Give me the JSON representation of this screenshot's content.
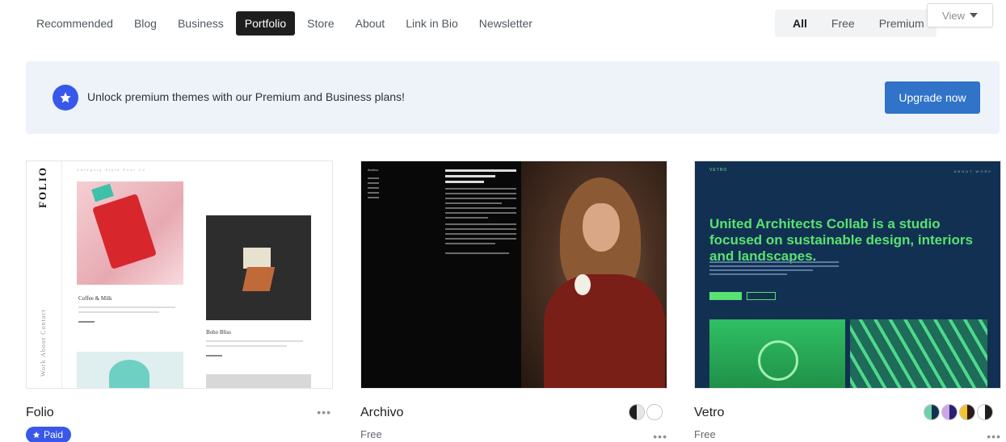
{
  "nav": {
    "items": [
      {
        "label": "Recommended",
        "active": false
      },
      {
        "label": "Blog",
        "active": false
      },
      {
        "label": "Business",
        "active": false
      },
      {
        "label": "Portfolio",
        "active": true
      },
      {
        "label": "Store",
        "active": false
      },
      {
        "label": "About",
        "active": false
      },
      {
        "label": "Link in Bio",
        "active": false
      },
      {
        "label": "Newsletter",
        "active": false
      }
    ]
  },
  "filter": {
    "items": [
      {
        "label": "All",
        "active": true
      },
      {
        "label": "Free",
        "active": false
      },
      {
        "label": "Premium",
        "active": false
      }
    ]
  },
  "view_dropdown": {
    "label": "View"
  },
  "banner": {
    "text": "Unlock premium themes with our Premium and Business plans!",
    "button_label": "Upgrade now"
  },
  "colors": {
    "accent": "#3858e9",
    "button": "#3073c8",
    "banner_bg": "#eef3f9",
    "vetro_green": "#59e272",
    "vetro_navy": "#123152"
  },
  "themes": [
    {
      "name": "Folio",
      "badge": "Paid",
      "badge_icon": "star-icon",
      "more": "•••",
      "preview": {
        "logo": "FOLIO",
        "side_nav": "Work   About   Contact",
        "top_nav": "Category  Style  Post  CV",
        "caption1": "Coffee & Milk",
        "caption2": "Boho Bliss"
      }
    },
    {
      "name": "Archivo",
      "price": "Free",
      "more": "•••",
      "preview": {
        "site_name": "Archivo"
      },
      "style_variations": [
        {
          "left": "#1e1e1e",
          "right": "#e6e6e6"
        },
        {
          "left": "#ffffff",
          "right": "#ffffff"
        }
      ]
    },
    {
      "name": "Vetro",
      "price": "Free",
      "more": "•••",
      "preview": {
        "logo": "VETRO",
        "nav": "ABOUT  WORK",
        "headline": "United Architects Collab is a studio focused on sustainable design, interiors and landscapes."
      },
      "style_variations": [
        {
          "left": "#6ed0a8",
          "right": "#123152"
        },
        {
          "left": "#c9a6e8",
          "right": "#2b1f6e"
        },
        {
          "left": "#f2c230",
          "right": "#2a1a1a"
        },
        {
          "left": "#ffffff",
          "right": "#1e1e1e"
        }
      ]
    }
  ]
}
